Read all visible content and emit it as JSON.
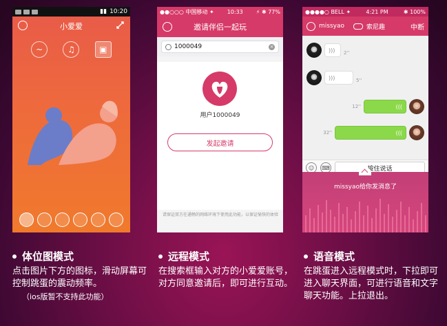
{
  "panel1": {
    "status_time": "10:20",
    "app_title": "小爱爱",
    "modes": [
      "~",
      "♫",
      "▣"
    ]
  },
  "panel2": {
    "carrier": "●●○○○ 中国移动 ✦",
    "time": "10:33",
    "battery": "⚡ ✱ 77%",
    "nav_title": "邀请伴侣一起玩",
    "search_value": "1000049",
    "user_label": "用户1000049",
    "invite_button": "发起邀请",
    "network_note": "请保证双方在通畅的网络环境下使用此功能，以保证愉快的体验"
  },
  "panel3": {
    "carrier": "●●●●○ BELL ✦",
    "time": "4:21 PM",
    "battery": "✱ 100%",
    "partner_name": "missyao",
    "partner2_name": "索尼趣",
    "disconnect": "中断",
    "messages": [
      {
        "side": "left",
        "duration": "2''"
      },
      {
        "side": "left",
        "duration": "5''"
      },
      {
        "side": "right",
        "duration": "12''"
      },
      {
        "side": "right",
        "duration": "32''"
      }
    ],
    "hold_to_talk": "按住说话",
    "notice": "missyao给你发消息了"
  },
  "captions": [
    {
      "title": "体位图模式",
      "body": "点击图片下方的图标，滑动屏幕可控制跳蛋的震动频率。",
      "note": "（ios版暂不支持此功能）"
    },
    {
      "title": "远程模式",
      "body": "在搜索框输入对方的小爱爱账号，对方同意邀请后，即可进行互动。"
    },
    {
      "title": "语音模式",
      "body": "在跳蛋进入远程模式时，下拉即可进入聊天界面，可进行语音和文字聊天功能。上拉退出。"
    }
  ]
}
